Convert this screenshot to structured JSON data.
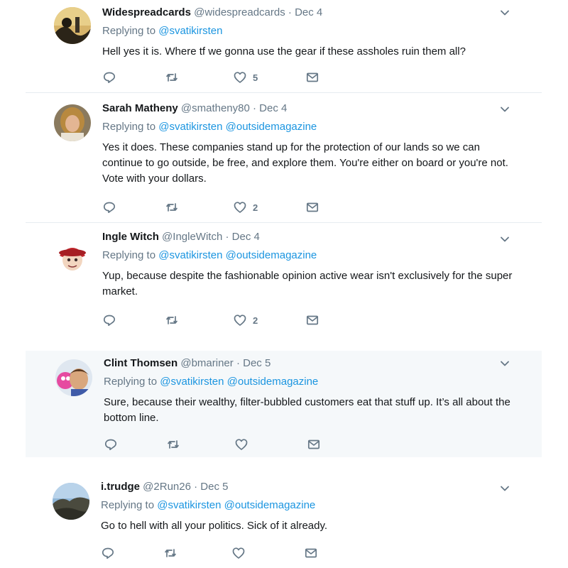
{
  "tweets": [
    {
      "name": "Widespreadcards",
      "handle": "@widespreadcards",
      "separator": "·",
      "date": "Dec 4",
      "replying_to": "Replying to",
      "mentions": [
        "@svatikirsten"
      ],
      "text": "Hell yes it is. Where tf we gonna use the gear if these assholes ruin them all?",
      "like_count": "5",
      "highlighted": false
    },
    {
      "name": "Sarah Matheny",
      "handle": "@smatheny80",
      "separator": "·",
      "date": "Dec 4",
      "replying_to": "Replying to",
      "mentions": [
        "@svatikirsten",
        "@outsidemagazine"
      ],
      "text": "Yes it does. These companies stand up for the protection of our lands so we can continue to go outside, be free, and explore them. You're either on board or you're not. Vote with your dollars.",
      "like_count": "2",
      "highlighted": false
    },
    {
      "name": "Ingle Witch",
      "handle": "@IngleWitch",
      "separator": "·",
      "date": "Dec 4",
      "replying_to": "Replying to",
      "mentions": [
        "@svatikirsten",
        "@outsidemagazine"
      ],
      "text": "Yup, because despite the fashionable opinion active wear isn't exclusively for the super market.",
      "like_count": "2",
      "highlighted": false
    },
    {
      "name": "Clint Thomsen",
      "handle": "@bmariner",
      "separator": "·",
      "date": "Dec 5",
      "replying_to": "Replying to",
      "mentions": [
        "@svatikirsten",
        "@outsidemagazine"
      ],
      "text": "Sure, because their wealthy, filter-bubbled customers eat that stuff up. It’s all about the bottom line.",
      "like_count": "",
      "highlighted": true
    },
    {
      "name": "i.trudge",
      "handle": "@2Run26",
      "separator": "·",
      "date": "Dec 5",
      "replying_to": "Replying to",
      "mentions": [
        "@svatikirsten",
        "@outsidemagazine"
      ],
      "text": "Go to hell with all your politics. Sick of it already.",
      "like_count": "",
      "highlighted": false
    }
  ],
  "icons": {
    "reply": "reply-icon",
    "retweet": "retweet-icon",
    "like": "heart-icon",
    "message": "envelope-icon",
    "more": "chevron-down-icon"
  },
  "colors": {
    "link": "#1b95e0",
    "secondary_text": "#657786",
    "highlight_bg": "#f5f8fa",
    "divider": "#e6ecf0"
  }
}
